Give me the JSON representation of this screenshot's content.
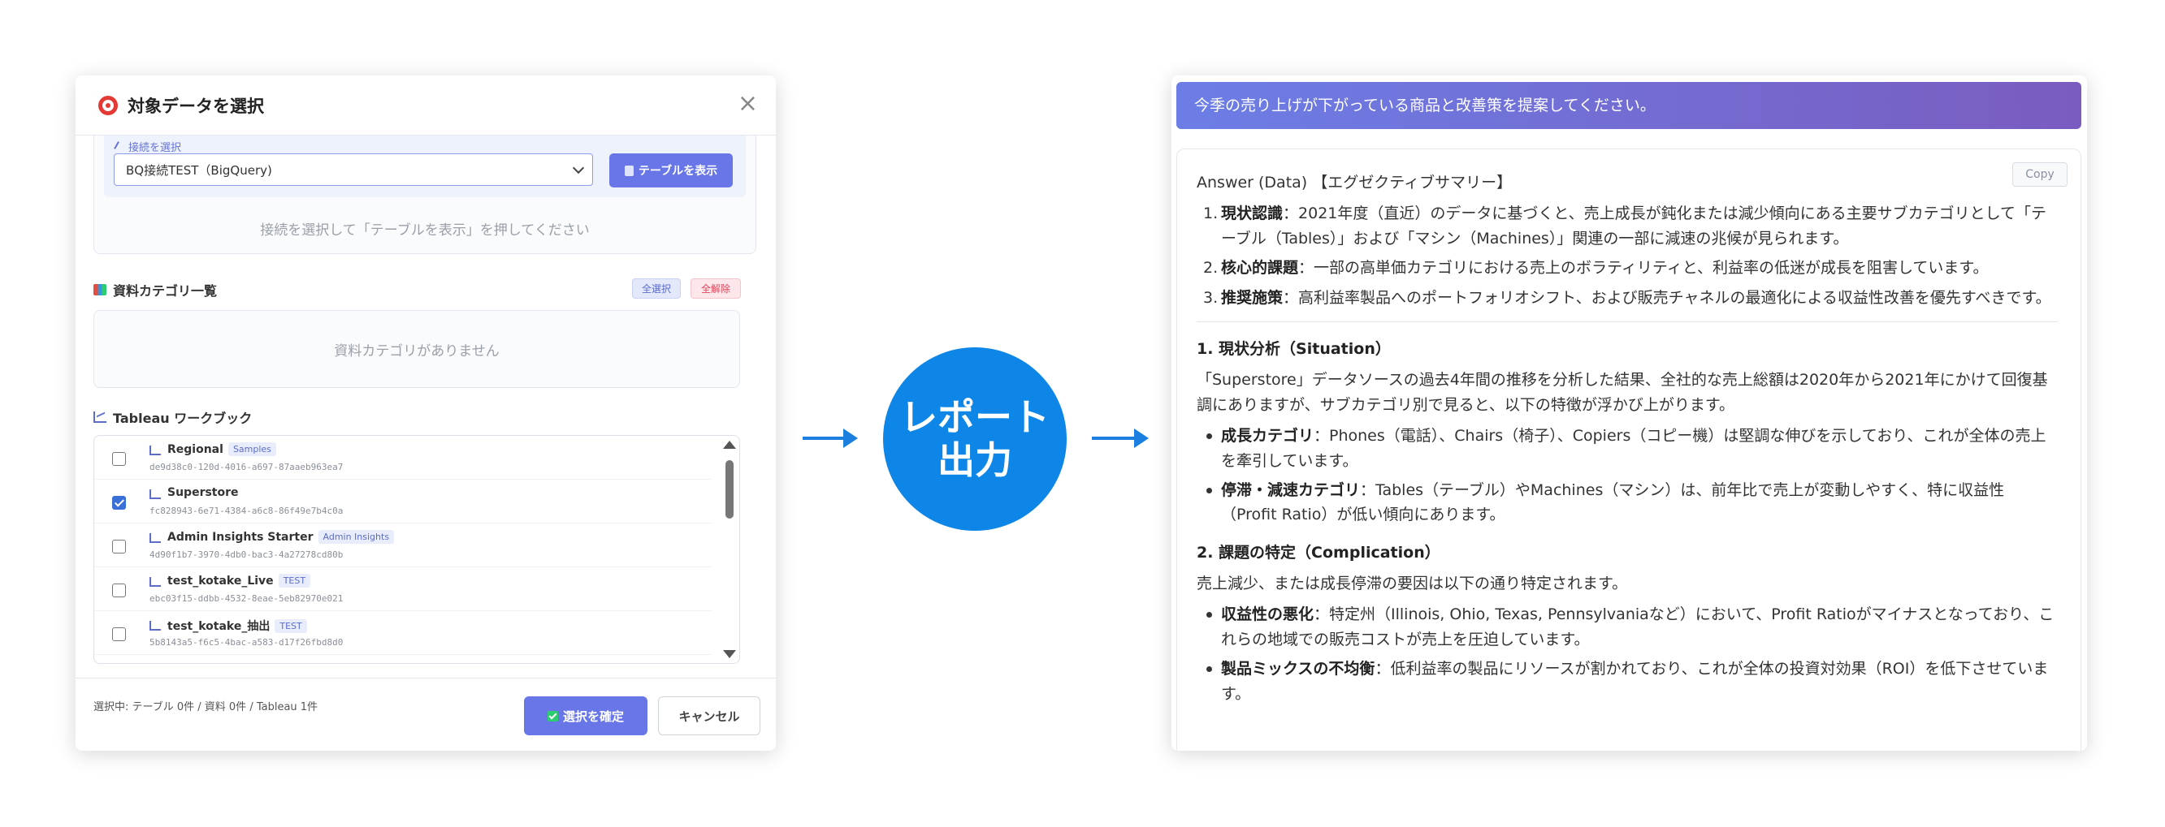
{
  "modal": {
    "title": "対象データを選択",
    "close_label": "×",
    "connection": {
      "label": "接続を選択",
      "selected": "BQ接続TEST（BigQuery)",
      "show_table_label": "テーブルを表示",
      "hint": "接続を選択して「テーブルを表示」を押してください"
    },
    "categories": {
      "title": "資料カテゴリ一覧",
      "select_all": "全選択",
      "clear_all": "全解除",
      "empty": "資料カテゴリがありません"
    },
    "workbooks": {
      "title": "Tableau ワークブック",
      "items": [
        {
          "name": "Regional",
          "tag": "Samples",
          "id": "de9d38c0-120d-4016-a697-87aaeb963ea7",
          "checked": false
        },
        {
          "name": "Superstore",
          "tag": "",
          "id": "fc828943-6e71-4384-a6c8-86f49e7b4c0a",
          "checked": true
        },
        {
          "name": "Admin Insights Starter",
          "tag": "Admin Insights",
          "id": "4d90f1b7-3970-4db0-bac3-4a27278cd80b",
          "checked": false
        },
        {
          "name": "test_kotake_Live",
          "tag": "TEST",
          "id": "ebc03f15-ddbb-4532-8eae-5eb82970e021",
          "checked": false
        },
        {
          "name": "test_kotake_抽出",
          "tag": "TEST",
          "id": "5b8143a5-f6c5-4bac-a583-d17f26fbd8d0",
          "checked": false
        }
      ]
    },
    "footer": {
      "status": "選択中: テーブル 0件 / 資料 0件 / Tableau 1件",
      "confirm_label": "選択を確定",
      "cancel_label": "キャンセル"
    }
  },
  "center": {
    "line1": "レポート",
    "line2": "出力"
  },
  "chat": {
    "user_message": "今季の売り上げが下がっている商品と改善策を提案してください。",
    "copy_label": "Copy",
    "answer_intro": "Answer (Data) 【エグゼクティブサマリー】",
    "summary": [
      {
        "bold": "現状認識",
        "text": "：2021年度（直近）のデータに基づくと、売上成長が鈍化または減少傾向にある主要サブカテゴリとして「テーブル（Tables）」および「マシン（Machines）」関連の一部に減速の兆候が見られます。"
      },
      {
        "bold": "核心的課題",
        "text": "：一部の高単価カテゴリにおける売上のボラティリティと、利益率の低迷が成長を阻害しています。"
      },
      {
        "bold": "推奨施策",
        "text": "：高利益率製品へのポートフォリオシフト、および販売チャネルの最適化による収益性改善を優先すべきです。"
      }
    ],
    "section1_title": "1. 現状分析（Situation）",
    "section1_para": "「Superstore」データソースの過去4年間の推移を分析した結果、全社的な売上総額は2020年から2021年にかけて回復基調にありますが、サブカテゴリ別で見ると、以下の特徴が浮かび上がります。",
    "section1_items": [
      {
        "bold": "成長カテゴリ",
        "text": "：Phones（電話）、Chairs（椅子）、Copiers（コピー機）は堅調な伸びを示しており、これが全体の売上を牽引しています。"
      },
      {
        "bold": "停滞・減速カテゴリ",
        "text": "：Tables（テーブル）やMachines（マシン）は、前年比で売上が変動しやすく、特に収益性（Profit Ratio）が低い傾向にあります。"
      }
    ],
    "section2_title": "2. 課題の特定（Complication）",
    "section2_para": "売上減少、または成長停滞の要因は以下の通り特定されます。",
    "section2_items": [
      {
        "bold": "収益性の悪化",
        "text": "：特定州（Illinois, Ohio, Texas, Pennsylvaniaなど）において、Profit Ratioがマイナスとなっており、これらの地域での販売コストが売上を圧迫しています。"
      },
      {
        "bold": "製品ミックスの不均衡",
        "text": "：低利益率の製品にリソースが割かれており、これが全体の投資対効果（ROI）を低下させています。"
      }
    ]
  }
}
